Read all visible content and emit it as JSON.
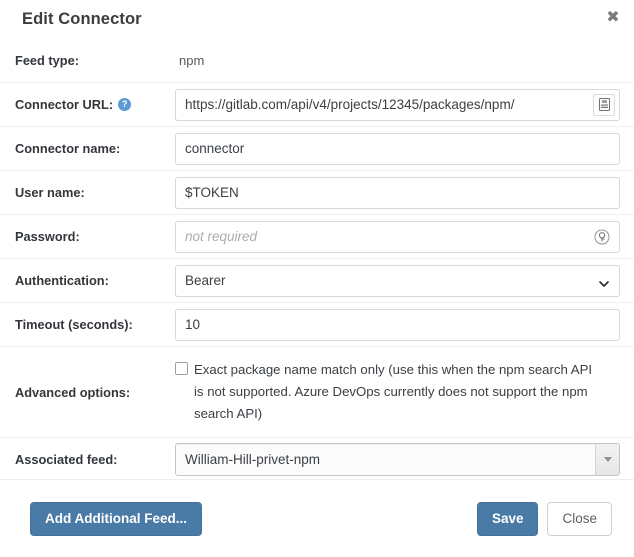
{
  "dialog": {
    "title": "Edit Connector",
    "close_label": "✖"
  },
  "fields": {
    "feed_type": {
      "label": "Feed type:",
      "value": "npm"
    },
    "connector_url": {
      "label": "Connector URL:",
      "value": "https://gitlab.com/api/v4/projects/12345/packages/npm/",
      "help_glyph": "?",
      "button_name": "browse-button"
    },
    "connector_name": {
      "label": "Connector name:",
      "value": "connector"
    },
    "user_name": {
      "label": "User name:",
      "value": "$TOKEN"
    },
    "password": {
      "label": "Password:",
      "value": "",
      "placeholder": "not required"
    },
    "authentication": {
      "label": "Authentication:",
      "value": "Bearer",
      "options": [
        "Bearer"
      ]
    },
    "timeout": {
      "label": "Timeout (seconds):",
      "value": "10"
    },
    "advanced_options": {
      "label": "Advanced options:",
      "checkbox_checked": false,
      "checkbox_text": "Exact package name match only (use this when the npm search API is not supported. Azure DevOps currently does not support the npm search API)"
    },
    "associated_feed": {
      "label": "Associated feed:",
      "value": "William-Hill-privet-npm",
      "options": [
        "William-Hill-privet-npm"
      ]
    }
  },
  "footer": {
    "add_feed_label": "Add Additional Feed...",
    "save_label": "Save",
    "close_label": "Close"
  },
  "colors": {
    "primary": "#4a7ba7",
    "help_icon": "#5b9bd5",
    "text": "#33373b",
    "border": "#d6d9dc"
  }
}
